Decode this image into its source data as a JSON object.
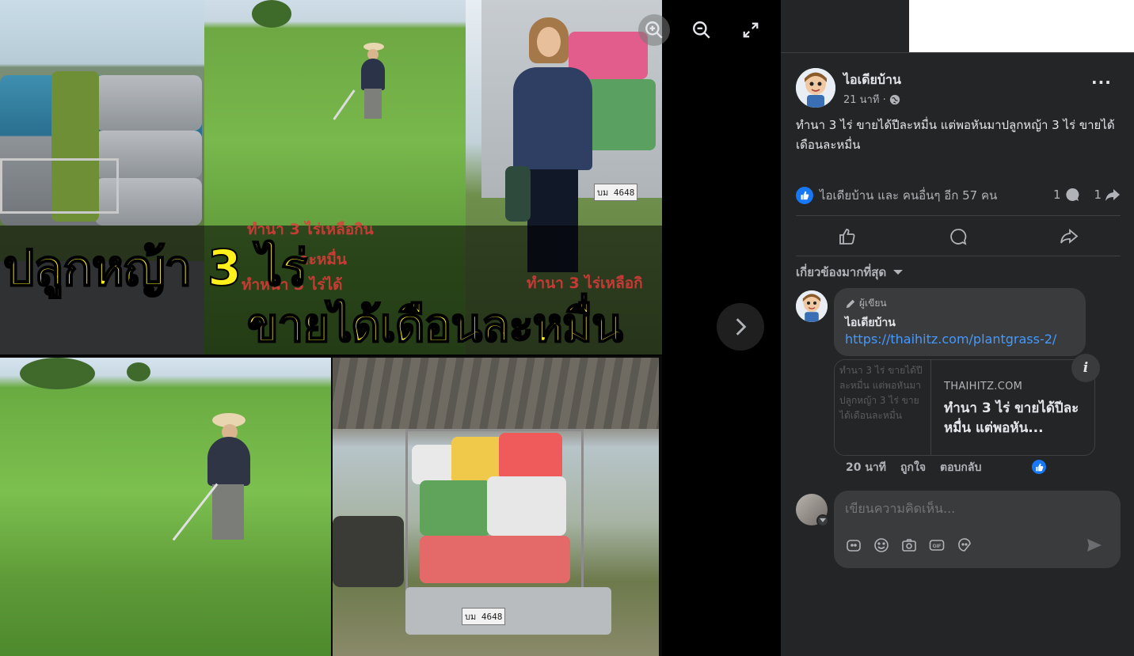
{
  "viewer": {
    "headline_line1": "ปลูกหญ้า 3 ไร่",
    "headline_line2": "ขายได้เดือนละหมื่น",
    "overlay_text_a": "ทำนา 3 ไร่เหลือกิน",
    "overlay_text_b": "ละหมื่น",
    "overlay_text_c": "ทำหน้า 3 ไร่ได้",
    "overlay_text_d": "ทำนา 3 ไร่เหลือกิ",
    "plate_top": "บม 4648",
    "plate_bottom": "บม 4648",
    "icons": [
      "zoom-in-icon",
      "zoom-out-icon",
      "fullscreen-icon",
      "chevron-right-icon"
    ]
  },
  "post": {
    "author": "ไอเดียบ้าน",
    "time": "21 นาที ·",
    "text": "ทำนา 3 ไร่ ขายได้ปีละหมื่น แต่พอหันมาปลูกหญ้า 3 ไร่ ขายได้เดือนละหมื่น",
    "reactions_text": "ไอเดียบ้าน และ คนอื่นๆ อีก 57 คน",
    "comments_count": "1",
    "shares_count": "1",
    "more": "···"
  },
  "filter": {
    "label": "เกี่ยวข้องมากที่สุด"
  },
  "comment": {
    "badge": "ผู้เขียน",
    "name": "ไอเดียบ้าน",
    "link": "https://thaihitz.com/plantgrass-2/",
    "card_thumb_alt": "ทำนา 3 ไร่ ขายได้ปีละหมื่น แต่พอหันมาปลูกหญ้า 3 ไร่ ขายได้เดือนละหมื่น",
    "card_domain": "THAIHITZ.COM",
    "card_title": "ทำนา 3 ไร่ ขายได้ปีละหมื่น แต่พอหัน...",
    "time": "20 นาที",
    "like_label": "ถูกใจ",
    "reply_label": "ตอบกลับ"
  },
  "composer": {
    "placeholder": "เขียนความคิดเห็น..."
  },
  "colors": {
    "panel_bg": "#242526",
    "bubble_bg": "#3a3b3c",
    "accent": "#1877f2",
    "link": "#4599ff",
    "headline_yellow": "#ffef1a"
  }
}
